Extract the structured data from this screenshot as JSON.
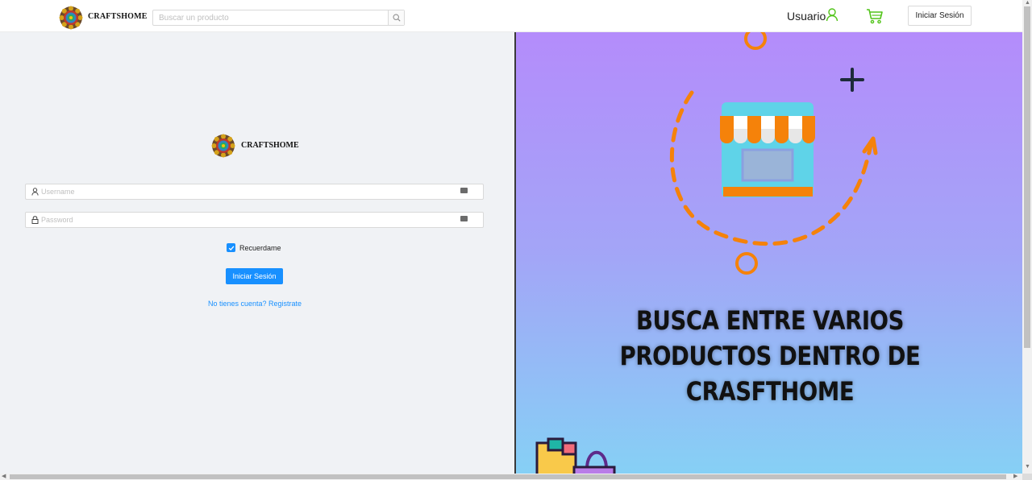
{
  "header": {
    "brand": "CRAFTSHOME",
    "search_placeholder": "Buscar un producto",
    "user_label": "Usuario",
    "login_button": "Iniciar Sesión",
    "icons": [
      "search-icon",
      "user-icon",
      "cart-icon"
    ]
  },
  "login_form": {
    "brand": "CRAFTSHOME",
    "username_placeholder": "Username",
    "password_placeholder": "Password",
    "remember_label": "Recuerdame",
    "remember_checked": true,
    "submit_label": "Iniciar Sesión",
    "register_link": "No tienes cuenta? Registrate"
  },
  "promo": {
    "line1": "BUSCA ENTRE VARIOS",
    "line2": "PRODUCTOS DENTRO DE",
    "line3": "CRASFTHOME"
  },
  "colors": {
    "accent": "#1890ff",
    "green_icon": "#52c41a",
    "promo_top": "#b48cfb",
    "promo_bottom": "#86d0f5",
    "shop_orange": "#f5820a"
  }
}
